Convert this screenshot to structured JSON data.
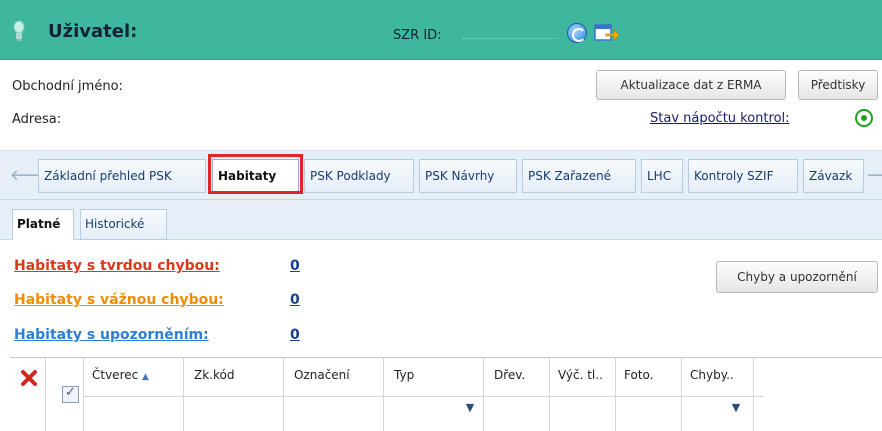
{
  "header": {
    "user_label": "Uživatel:",
    "szr_label": "SZR ID:",
    "icons": [
      "lightbulb-icon",
      "refresh-icon",
      "export-icon"
    ]
  },
  "info": {
    "business_name_label": "Obchodní jméno:",
    "address_label": "Adresa:",
    "erma_button": "Aktualizace dat z ERMA",
    "print_button": "Předtisky",
    "control_status_link": "Stav nápočtu kontrol:"
  },
  "tabs": [
    {
      "label": "Základní přehled PSK",
      "active": false
    },
    {
      "label": "Habitaty",
      "active": true
    },
    {
      "label": "PSK Podklady",
      "active": false
    },
    {
      "label": "PSK Návrhy",
      "active": false
    },
    {
      "label": "PSK Zařazené",
      "active": false
    },
    {
      "label": "LHC",
      "active": false
    },
    {
      "label": "Kontroly SZIF",
      "active": false
    },
    {
      "label": "Závazk",
      "active": false
    }
  ],
  "subtabs": [
    {
      "label": "Platné",
      "active": true
    },
    {
      "label": "Historické",
      "active": false
    }
  ],
  "summary": [
    {
      "label": "Habitaty s tvrdou chybou:",
      "count": "0",
      "color": "#d9391c"
    },
    {
      "label": "Habitaty s vážnou chybou:",
      "count": "0",
      "color": "#f08c00"
    },
    {
      "label": "Habitaty s upozorněním:",
      "count": "0",
      "color": "#2e7fd4"
    }
  ],
  "errors_button": "Chyby a upozornění",
  "grid": {
    "columns": [
      "Čtverec",
      "Zk.kód",
      "Označení",
      "Typ",
      "Dřev.",
      "Výč. tl..",
      "Foto.",
      "Chyby.."
    ],
    "sorted_column": "Čtverec",
    "sort_direction": "ascending"
  },
  "colors": {
    "header_bg": "#3fb69e",
    "tab_strip_bg": "#e6eef7",
    "highlight": "#e0262a"
  }
}
